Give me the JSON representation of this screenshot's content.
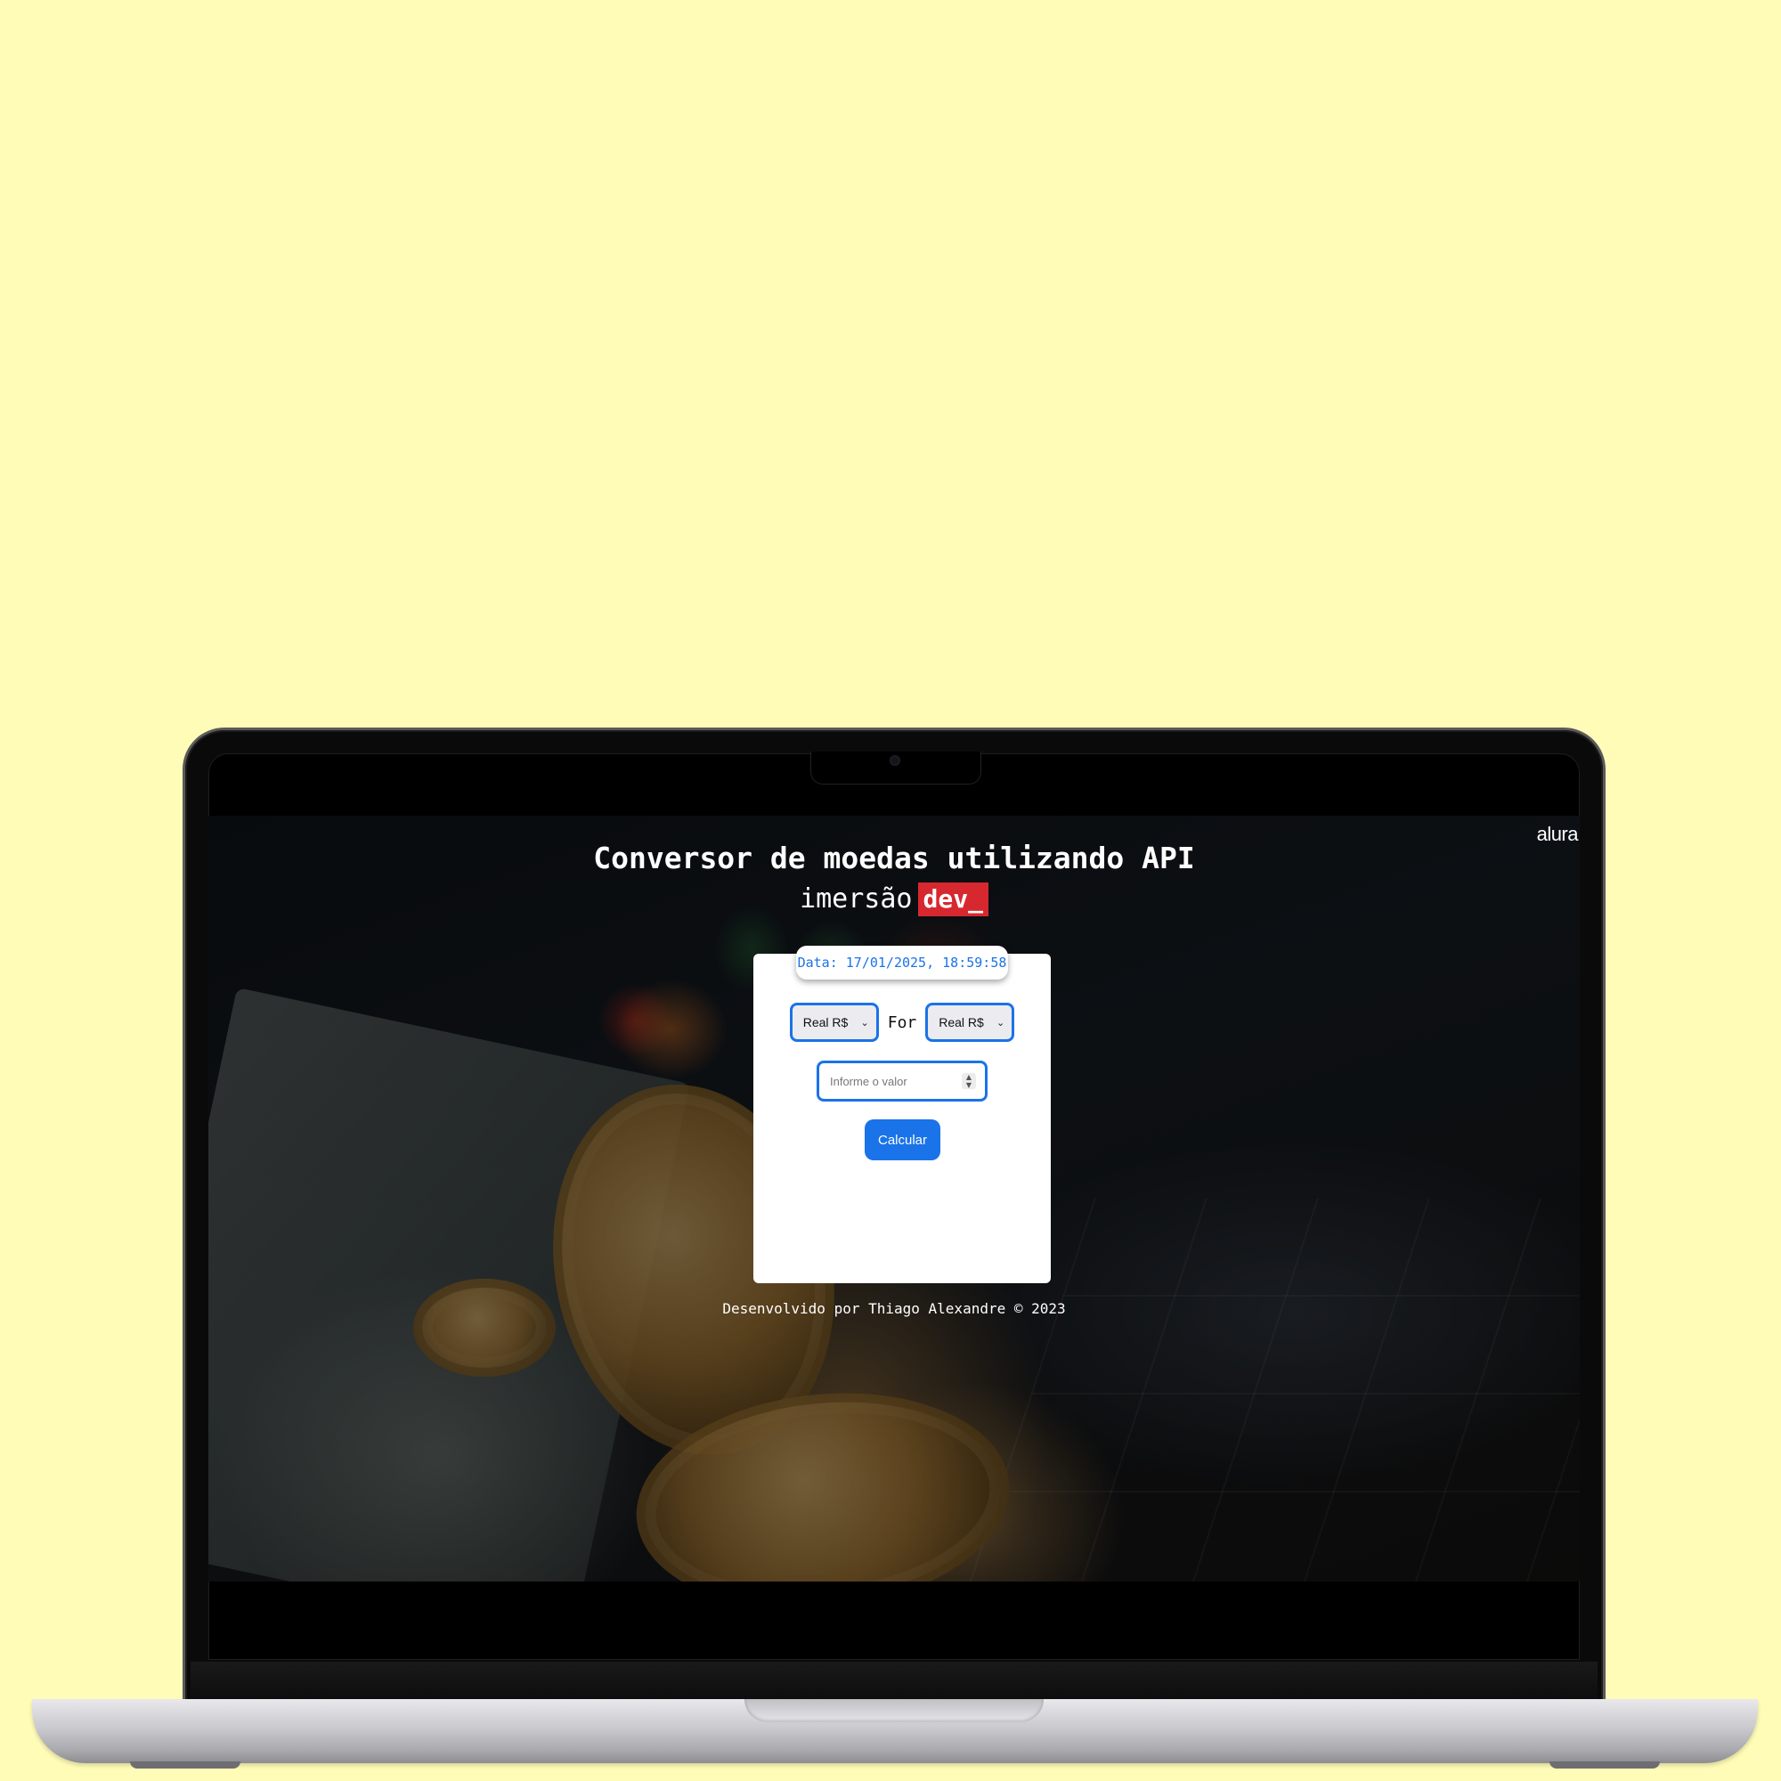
{
  "app": {
    "title": "Conversor de moedas utilizando API",
    "brand_word": "imersão",
    "brand_tag": "dev_",
    "corner_logo": "alura"
  },
  "converter": {
    "date_label": "Data: 17/01/2025, 18:59:58",
    "from_select": {
      "selected": "Real R$"
    },
    "separator_label": "For",
    "to_select": {
      "selected": "Real R$"
    },
    "amount_input": {
      "placeholder": "Informe o valor",
      "value": ""
    },
    "submit_label": "Calcular"
  },
  "footer": {
    "credit": "Desenvolvido por Thiago Alexandre © 2023"
  },
  "colors": {
    "background": "#fffcb7",
    "accent": "#1a73e8",
    "brand_red": "#d7282f",
    "card": "#ffffff"
  },
  "icons": {
    "select_arrow": "chevron-down-icon",
    "number_stepper": "stepper-icon",
    "camera": "camera-icon"
  }
}
